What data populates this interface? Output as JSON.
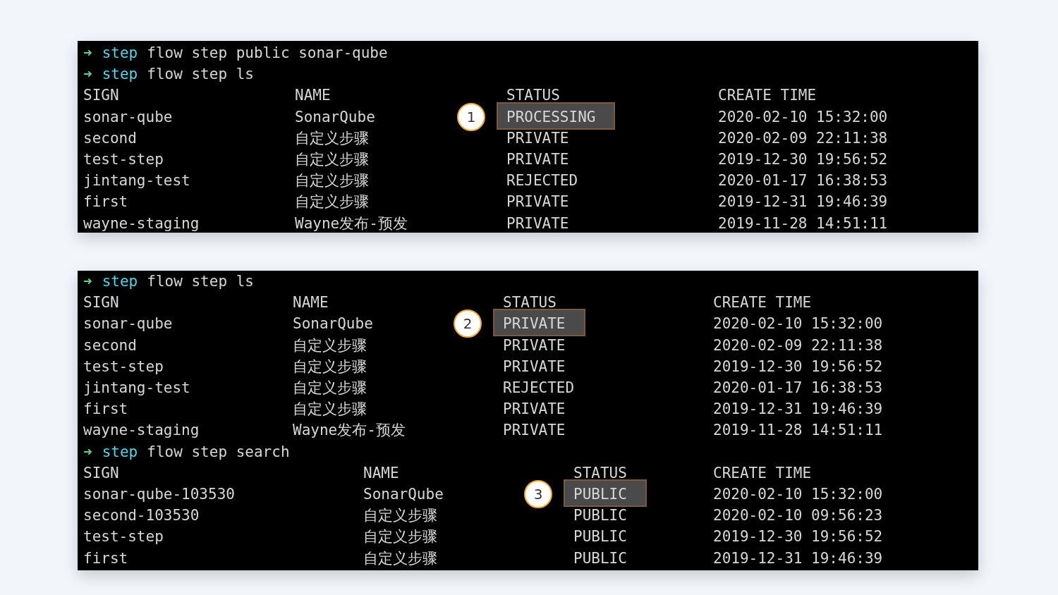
{
  "panels": [
    {
      "blocks": [
        {
          "kind": "prompt",
          "arrow": "➜",
          "command": "step",
          "args": "flow step public sonar-qube"
        },
        {
          "kind": "prompt",
          "arrow": "➜",
          "command": "step",
          "args": "flow step ls"
        },
        {
          "kind": "table",
          "columns": [
            "SIGN",
            "NAME",
            "STATUS",
            "CREATE TIME"
          ],
          "rows": [
            {
              "cells": [
                "sonar-qube",
                "SonarQube",
                "PROCESSING",
                "2020-02-10 15:32:00"
              ],
              "highlighted": true,
              "callout": "1"
            },
            {
              "cells": [
                "second",
                "自定义步骤",
                "PRIVATE",
                "2020-02-09 22:11:38"
              ],
              "highlighted": false
            },
            {
              "cells": [
                "test-step",
                "自定义步骤",
                "PRIVATE",
                "2019-12-30 19:56:52"
              ],
              "highlighted": false
            },
            {
              "cells": [
                "jintang-test",
                "自定义步骤",
                "REJECTED",
                "2020-01-17 16:38:53"
              ],
              "highlighted": false
            },
            {
              "cells": [
                "first",
                "自定义步骤",
                "PRIVATE",
                "2019-12-31 19:46:39"
              ],
              "highlighted": false
            },
            {
              "cells": [
                "wayne-staging",
                "Wayne发布-预发",
                "PRIVATE",
                "2019-11-28 14:51:11"
              ],
              "highlighted": false
            }
          ]
        }
      ]
    },
    {
      "blocks": [
        {
          "kind": "prompt",
          "arrow": "➜",
          "command": "step",
          "args": "flow step ls"
        },
        {
          "kind": "table",
          "columns": [
            "SIGN",
            "NAME",
            "STATUS",
            "CREATE TIME"
          ],
          "rows": [
            {
              "cells": [
                "sonar-qube",
                "SonarQube",
                "PRIVATE",
                "2020-02-10 15:32:00"
              ],
              "highlighted": true,
              "callout": "2"
            },
            {
              "cells": [
                "second",
                "自定义步骤",
                "PRIVATE",
                "2020-02-09 22:11:38"
              ],
              "highlighted": false
            },
            {
              "cells": [
                "test-step",
                "自定义步骤",
                "PRIVATE",
                "2019-12-30 19:56:52"
              ],
              "highlighted": false
            },
            {
              "cells": [
                "jintang-test",
                "自定义步骤",
                "REJECTED",
                "2020-01-17 16:38:53"
              ],
              "highlighted": false
            },
            {
              "cells": [
                "first",
                "自定义步骤",
                "PRIVATE",
                "2019-12-31 19:46:39"
              ],
              "highlighted": false
            },
            {
              "cells": [
                "wayne-staging",
                "Wayne发布-预发",
                "PRIVATE",
                "2019-11-28 14:51:11"
              ],
              "highlighted": false
            }
          ]
        },
        {
          "kind": "prompt",
          "arrow": "➜",
          "command": "step",
          "args": "flow step search"
        },
        {
          "kind": "table",
          "columns": [
            "SIGN",
            "NAME",
            "STATUS",
            "CREATE TIME"
          ],
          "rows": [
            {
              "cells": [
                "sonar-qube-103530",
                "SonarQube",
                "PUBLIC",
                "2020-02-10 15:32:00"
              ],
              "highlighted": true,
              "callout": "3"
            },
            {
              "cells": [
                "second-103530",
                "自定义步骤",
                "PUBLIC",
                "2020-02-10 09:56:23"
              ],
              "highlighted": false
            },
            {
              "cells": [
                "test-step",
                "自定义步骤",
                "PUBLIC",
                "2019-12-30 19:56:52"
              ],
              "highlighted": false
            },
            {
              "cells": [
                "first",
                "自定义步骤",
                "PUBLIC",
                "2019-12-31 19:46:39"
              ],
              "highlighted": false
            }
          ]
        }
      ]
    }
  ]
}
